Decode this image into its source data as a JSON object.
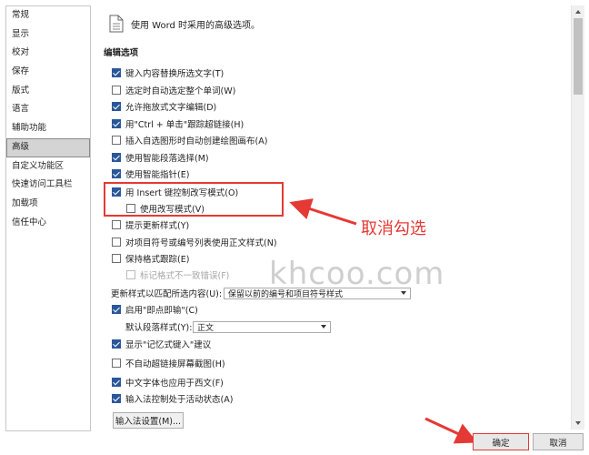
{
  "nav": [
    "常规",
    "显示",
    "校对",
    "保存",
    "版式",
    "语言",
    "辅助功能",
    "高级",
    "自定义功能区",
    "快速访问工具栏",
    "加载项",
    "信任中心"
  ],
  "header": {
    "icon": "document-icon",
    "text": "使用 Word 时采用的高级选项。"
  },
  "section_title": "编辑选项",
  "options": [
    {
      "label": "键入内容替换所选文字(T)",
      "checked": true
    },
    {
      "label": "选定时自动选定整个单词(W)",
      "checked": false
    },
    {
      "label": "允许拖放式文字编辑(D)",
      "checked": true
    },
    {
      "label": "用\"Ctrl + 单击\"跟踪超链接(H)",
      "checked": true
    },
    {
      "label": "插入自选图形时自动创建绘图画布(A)",
      "checked": false
    },
    {
      "label": "使用智能段落选择(M)",
      "checked": true
    },
    {
      "label": "使用智能指针(E)",
      "checked": true
    },
    {
      "label": "用 Insert 键控制改写模式(O)",
      "checked": true
    },
    {
      "label": "使用改写模式(V)",
      "checked": false
    },
    {
      "label": "提示更新样式(Y)",
      "checked": false
    },
    {
      "label": "对项目符号或编号列表使用正文样式(N)",
      "checked": false
    },
    {
      "label": "保持格式跟踪(E)",
      "checked": false
    },
    {
      "label": "标记格式不一致错误(F)",
      "checked": false
    },
    {
      "label": "启用\"即点即输\"(C)",
      "checked": true
    },
    {
      "label": "显示\"记忆式键入\"建议",
      "checked": true
    },
    {
      "label": "不自动超链接屏幕截图(H)",
      "checked": false
    },
    {
      "label": "中文字体也应用于西文(F)",
      "checked": true
    },
    {
      "label": "输入法控制处于活动状态(A)",
      "checked": true
    }
  ],
  "update_style": {
    "label": "更新样式以匹配所选内容(U):",
    "value": "保留以前的编号和项目符号样式"
  },
  "default_para": {
    "label": "默认段落样式(Y):",
    "value": "正文"
  },
  "ime_button": "输入法设置(M)...",
  "annotation": {
    "text": "取消勾选",
    "color": "#e53935"
  },
  "watermark": "khcoo.com",
  "buttons": {
    "ok": "确定",
    "cancel": "取消"
  }
}
